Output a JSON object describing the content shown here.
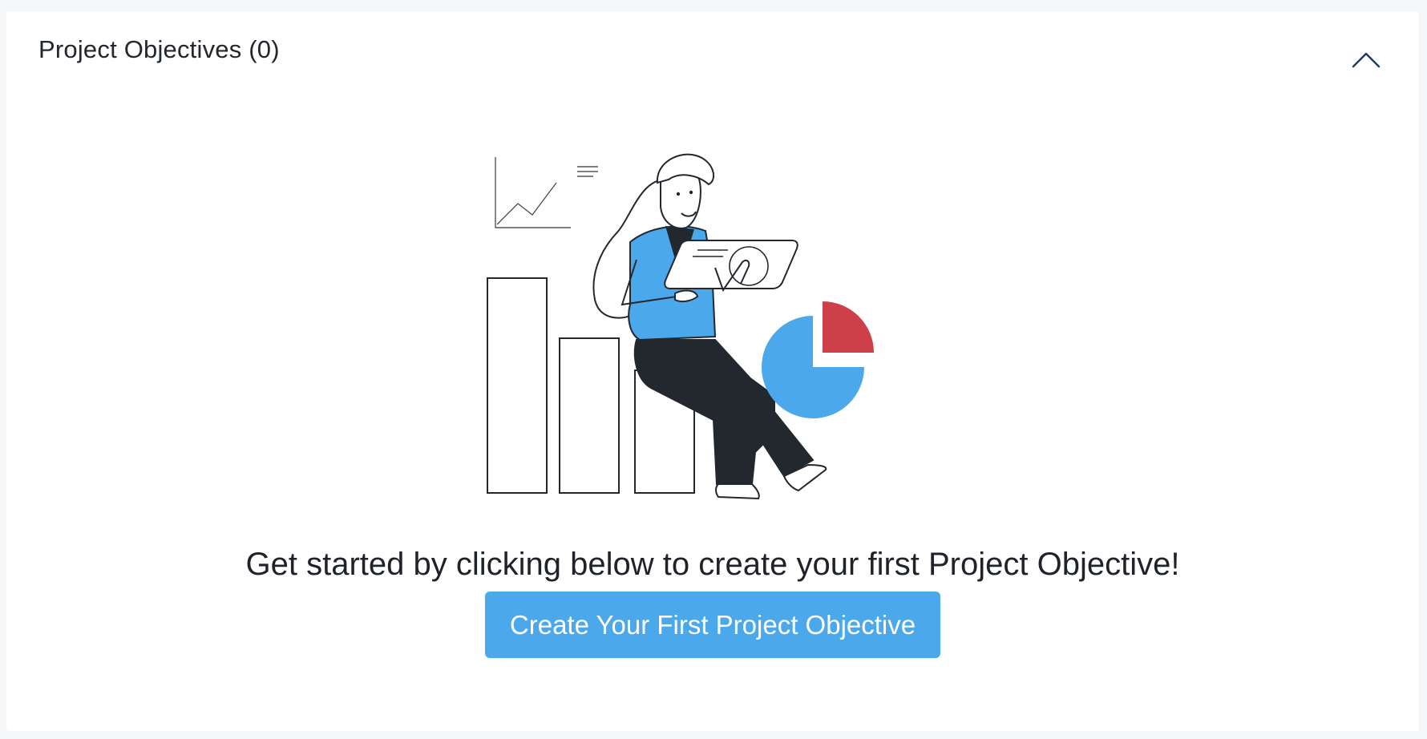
{
  "panel": {
    "title": "Project Objectives (0)",
    "toggle_icon": "chevron-up-icon"
  },
  "empty_state": {
    "illustration": "person-with-charts-illustration",
    "message": "Get started by clicking below to create your first Project Objective!",
    "button_label": "Create Your First Project Objective"
  },
  "colors": {
    "accent": "#4aa8eb",
    "pie_highlight": "#cd3f49",
    "dark": "#23272e",
    "toggle": "#1f3a5f"
  }
}
